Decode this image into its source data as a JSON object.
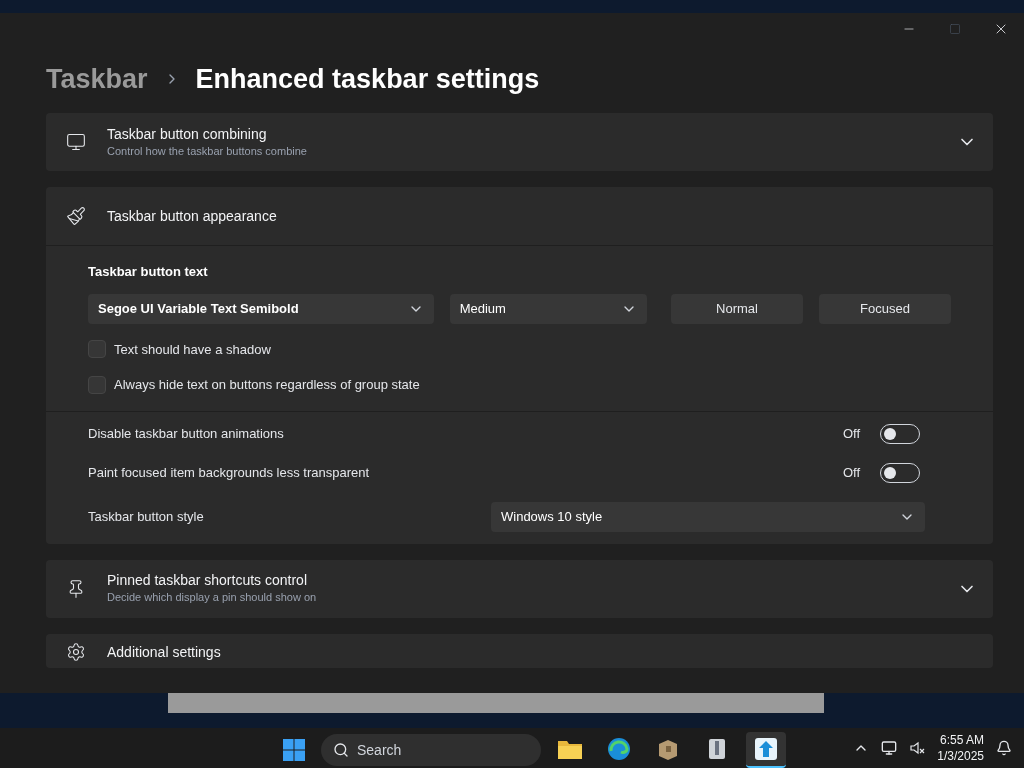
{
  "breadcrumb": {
    "parent": "Taskbar",
    "current": "Enhanced taskbar settings"
  },
  "sections": [
    {
      "kind": "combine",
      "title": "Taskbar button combining",
      "subtitle": "Control how the taskbar buttons combine",
      "expanded": false
    },
    {
      "kind": "appearance",
      "title": "Taskbar button appearance",
      "expanded": true,
      "text_heading": "Taskbar button text",
      "font": "Segoe UI Variable Text Semibold",
      "weight": "Medium",
      "color_buttons": [
        "Normal",
        "Focused"
      ],
      "checkboxes": [
        {
          "label": "Text should have a shadow",
          "checked": false
        },
        {
          "label": "Always hide text on buttons regardless of group state",
          "checked": false
        }
      ],
      "toggles": [
        {
          "label": "Disable taskbar button animations",
          "state": "Off",
          "on": false
        },
        {
          "label": "Paint focused item backgrounds less transparent",
          "state": "Off",
          "on": false
        }
      ],
      "style": {
        "label": "Taskbar button style",
        "value": "Windows 10 style"
      }
    },
    {
      "kind": "pin",
      "title": "Pinned taskbar shortcuts control",
      "subtitle": "Decide which display a pin should show on",
      "expanded": false
    },
    {
      "kind": "additional",
      "title": "Additional settings",
      "expanded": false
    }
  ],
  "taskbar": {
    "search": "Search",
    "apps": [
      {
        "kind": "folder",
        "selected": false
      },
      {
        "kind": "browser",
        "selected": false
      },
      {
        "kind": "box",
        "selected": false
      },
      {
        "kind": "archive",
        "selected": false
      },
      {
        "kind": "arrow",
        "selected": true
      }
    ],
    "time": "6:55 AM",
    "date": "1/3/2025"
  }
}
